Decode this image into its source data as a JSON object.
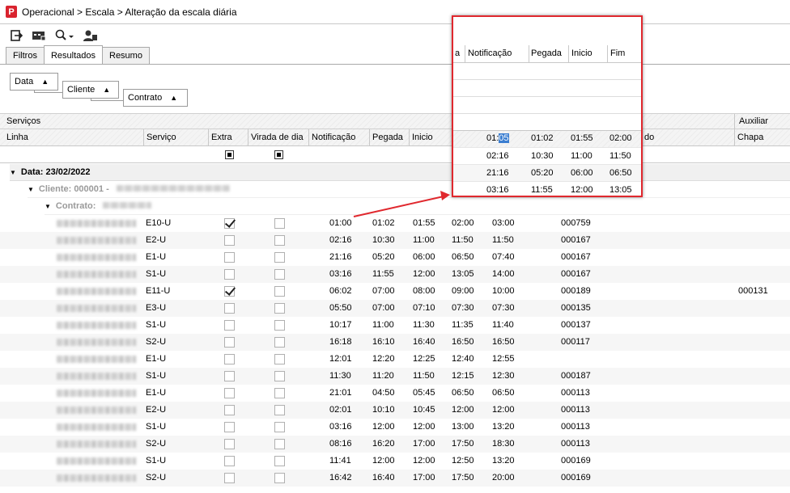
{
  "window": {
    "title": "Operacional > Escala > Alteração da escala diária"
  },
  "toolbar": {
    "buttons": [
      "export-icon",
      "card-icon",
      "search-icon",
      "user-icon"
    ]
  },
  "tabs": [
    "Filtros",
    "Resultados",
    "Resumo"
  ],
  "grouping": {
    "data": "Data",
    "cliente": "Cliente",
    "contrato": "Contrato"
  },
  "bands": {
    "servicos": "Serviços",
    "auxiliar": "Auxiliar"
  },
  "columns": {
    "linha": "Linha",
    "servico": "Serviço",
    "extra": "Extra",
    "virada": "Virada de dia",
    "notificacao": "Notificação",
    "pegada": "Pegada",
    "inicio": "Inicio",
    "hidden_tail": "do",
    "chapa": "Chapa"
  },
  "groups": {
    "data": "Data: 23/02/2022",
    "cliente": "Cliente: 000001 -",
    "contrato": "Contrato:"
  },
  "rows": [
    {
      "servico": "E10-U",
      "extra": true,
      "virada": false,
      "notificacao": "01:00",
      "pegada": "01:02",
      "inicio": "01:55",
      "fim": "02:00",
      "col_d": "03:00",
      "chapa": "000759",
      "auxiliar": ""
    },
    {
      "servico": "E2-U",
      "extra": false,
      "virada": false,
      "notificacao": "02:16",
      "pegada": "10:30",
      "inicio": "11:00",
      "fim": "11:50",
      "col_d": "11:50",
      "chapa": "000167",
      "auxiliar": ""
    },
    {
      "servico": "E1-U",
      "extra": false,
      "virada": false,
      "notificacao": "21:16",
      "pegada": "05:20",
      "inicio": "06:00",
      "fim": "06:50",
      "col_d": "07:40",
      "chapa": "000167",
      "auxiliar": ""
    },
    {
      "servico": "S1-U",
      "extra": false,
      "virada": false,
      "notificacao": "03:16",
      "pegada": "11:55",
      "inicio": "12:00",
      "fim": "13:05",
      "col_d": "14:00",
      "chapa": "000167",
      "auxiliar": ""
    },
    {
      "servico": "E11-U",
      "extra": true,
      "virada": false,
      "notificacao": "06:02",
      "pegada": "07:00",
      "inicio": "08:00",
      "fim": "09:00",
      "col_d": "10:00",
      "chapa": "000189",
      "auxiliar": "000131"
    },
    {
      "servico": "E3-U",
      "extra": false,
      "virada": false,
      "notificacao": "05:50",
      "pegada": "07:00",
      "inicio": "07:10",
      "fim": "07:30",
      "col_d": "07:30",
      "chapa": "000135",
      "auxiliar": ""
    },
    {
      "servico": "S1-U",
      "extra": false,
      "virada": false,
      "notificacao": "10:17",
      "pegada": "11:00",
      "inicio": "11:30",
      "fim": "11:35",
      "col_d": "11:40",
      "chapa": "000137",
      "auxiliar": ""
    },
    {
      "servico": "S2-U",
      "extra": false,
      "virada": false,
      "notificacao": "16:18",
      "pegada": "16:10",
      "inicio": "16:40",
      "fim": "16:50",
      "col_d": "16:50",
      "chapa": "000117",
      "auxiliar": ""
    },
    {
      "servico": "E1-U",
      "extra": false,
      "virada": false,
      "notificacao": "12:01",
      "pegada": "12:20",
      "inicio": "12:25",
      "fim": "12:40",
      "col_d": "12:55",
      "chapa": "",
      "auxiliar": ""
    },
    {
      "servico": "S1-U",
      "extra": false,
      "virada": false,
      "notificacao": "11:30",
      "pegada": "11:20",
      "inicio": "11:50",
      "fim": "12:15",
      "col_d": "12:30",
      "chapa": "000187",
      "auxiliar": ""
    },
    {
      "servico": "E1-U",
      "extra": false,
      "virada": false,
      "notificacao": "21:01",
      "pegada": "04:50",
      "inicio": "05:45",
      "fim": "06:50",
      "col_d": "06:50",
      "chapa": "000113",
      "auxiliar": ""
    },
    {
      "servico": "E2-U",
      "extra": false,
      "virada": false,
      "notificacao": "02:01",
      "pegada": "10:10",
      "inicio": "10:45",
      "fim": "12:00",
      "col_d": "12:00",
      "chapa": "000113",
      "auxiliar": ""
    },
    {
      "servico": "S1-U",
      "extra": false,
      "virada": false,
      "notificacao": "03:16",
      "pegada": "12:00",
      "inicio": "12:00",
      "fim": "13:00",
      "col_d": "13:20",
      "chapa": "000113",
      "auxiliar": ""
    },
    {
      "servico": "S2-U",
      "extra": false,
      "virada": false,
      "notificacao": "08:16",
      "pegada": "16:20",
      "inicio": "17:00",
      "fim": "17:50",
      "col_d": "18:30",
      "chapa": "000113",
      "auxiliar": ""
    },
    {
      "servico": "S1-U",
      "extra": false,
      "virada": false,
      "notificacao": "11:41",
      "pegada": "12:00",
      "inicio": "12:00",
      "fim": "12:50",
      "col_d": "13:20",
      "chapa": "000169",
      "auxiliar": ""
    },
    {
      "servico": "S2-U",
      "extra": false,
      "virada": false,
      "notificacao": "16:42",
      "pegada": "16:40",
      "inicio": "17:00",
      "fim": "17:50",
      "col_d": "20:00",
      "chapa": "000169",
      "auxiliar": ""
    }
  ],
  "zoom": {
    "headers": {
      "a": "a",
      "notificacao": "Notificação",
      "pegada": "Pegada",
      "inicio": "Inicio",
      "fim": "Fim"
    },
    "selected_prefix": "01:",
    "selected_part": "05",
    "rows": [
      {
        "notificacao": "",
        "pegada": "01:02",
        "inicio": "01:55",
        "fim": "02:00"
      },
      {
        "notificacao": "02:16",
        "pegada": "10:30",
        "inicio": "11:00",
        "fim": "11:50"
      },
      {
        "notificacao": "21:16",
        "pegada": "05:20",
        "inicio": "06:00",
        "fim": "06:50"
      },
      {
        "notificacao": "03:16",
        "pegada": "11:55",
        "inicio": "12:00",
        "fim": "13:05"
      }
    ]
  },
  "colors": {
    "highlight_border": "#e0282e",
    "selection": "#3b7ed1",
    "app_icon": "#d9232e"
  }
}
